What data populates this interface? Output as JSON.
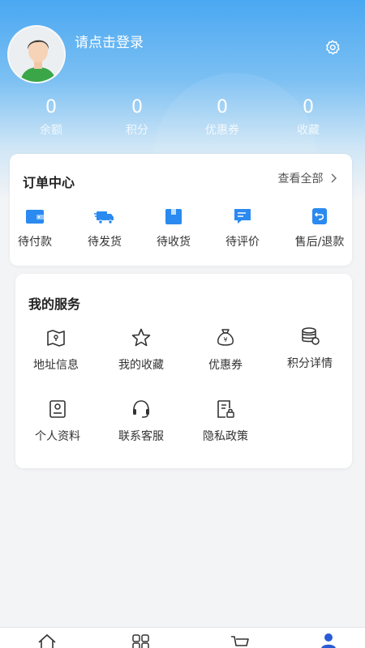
{
  "profile": {
    "login_prompt": "请点击登录"
  },
  "stats": [
    {
      "value": "0",
      "label": "余额"
    },
    {
      "value": "0",
      "label": "积分"
    },
    {
      "value": "0",
      "label": "优惠券"
    },
    {
      "value": "0",
      "label": "收藏"
    }
  ],
  "orders": {
    "title": "订单中心",
    "view_all": "查看全部",
    "items": [
      {
        "label": "待付款",
        "icon": "wallet-icon"
      },
      {
        "label": "待发货",
        "icon": "truck-icon"
      },
      {
        "label": "待收货",
        "icon": "box-icon"
      },
      {
        "label": "待评价",
        "icon": "comment-icon"
      },
      {
        "label": "售后/退款",
        "icon": "refund-icon"
      }
    ]
  },
  "services": {
    "title": "我的服务",
    "items": [
      {
        "label": "地址信息",
        "icon": "map-icon"
      },
      {
        "label": "我的收藏",
        "icon": "star-icon"
      },
      {
        "label": "优惠券",
        "icon": "money-bag-icon"
      },
      {
        "label": "积分详情",
        "icon": "coins-icon"
      },
      {
        "label": "个人资料",
        "icon": "profile-card-icon"
      },
      {
        "label": "联系客服",
        "icon": "headset-icon"
      },
      {
        "label": "隐私政策",
        "icon": "document-lock-icon"
      }
    ]
  },
  "tabbar": {
    "items": [
      {
        "icon": "home-icon"
      },
      {
        "icon": "category-icon"
      },
      {
        "icon": "cart-icon"
      },
      {
        "icon": "user-icon",
        "active": true
      }
    ]
  },
  "colors": {
    "accent": "#2a8af0",
    "header_top": "#4aa8f2"
  }
}
